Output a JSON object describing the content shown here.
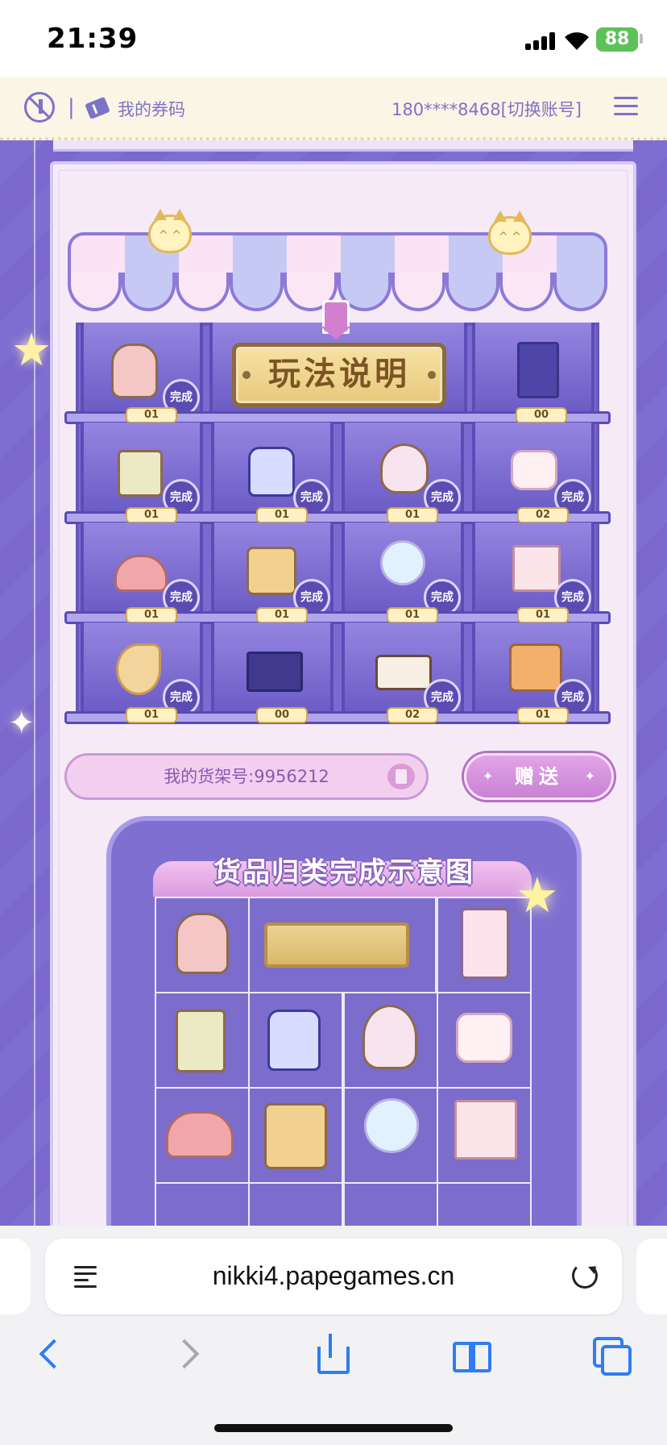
{
  "status_bar": {
    "time": "21:39",
    "battery": "88"
  },
  "site_bar": {
    "coupon_label": "我的券码",
    "account": "180****8468[切换账号]"
  },
  "shelf": {
    "intro_sign": "玩法说明",
    "done_label": "完成",
    "rows": [
      {
        "counts": [
          "01",
          "",
          "",
          "00"
        ]
      },
      {
        "counts": [
          "01",
          "01",
          "01",
          "02"
        ]
      },
      {
        "counts": [
          "01",
          "01",
          "01",
          "01"
        ]
      },
      {
        "counts": [
          "01",
          "00",
          "02",
          "01"
        ]
      }
    ]
  },
  "shelf_id": {
    "label": "我的货架号:9956212"
  },
  "gift_button": {
    "label": "赠送"
  },
  "example": {
    "title": "货品归类完成示意图"
  },
  "safari": {
    "url": "nikki4.papegames.cn"
  },
  "colors": {
    "accent": "#7a68cf",
    "panel": "#f6eaf7",
    "gold": "#e7c97c",
    "safari_blue": "#2f7cf6"
  }
}
